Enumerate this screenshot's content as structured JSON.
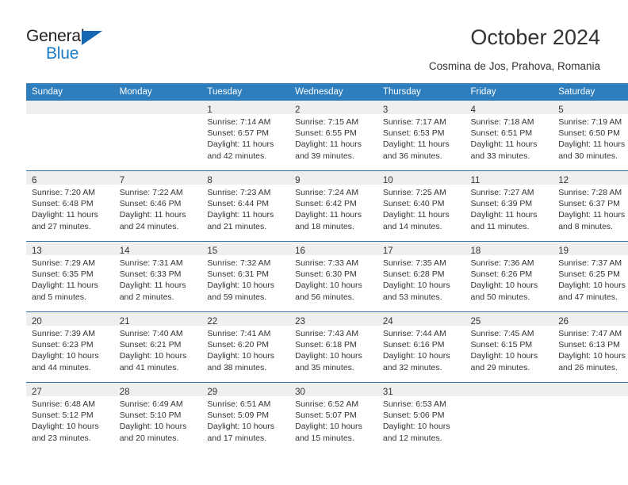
{
  "brand": {
    "name_top": "General",
    "name_bottom": "Blue",
    "triangle_color": "#1668b3",
    "blue_text_color": "#1a7cc4"
  },
  "header": {
    "title": "October 2024",
    "subtitle": "Cosmina de Jos, Prahova, Romania"
  },
  "calendar": {
    "header_bg": "#2e7ebd",
    "row_divider_color": "#2e6da4",
    "date_strip_bg": "#efefef",
    "weekday_headers": [
      "Sunday",
      "Monday",
      "Tuesday",
      "Wednesday",
      "Thursday",
      "Friday",
      "Saturday"
    ],
    "weeks": [
      [
        {
          "date": "",
          "lines": []
        },
        {
          "date": "",
          "lines": []
        },
        {
          "date": "1",
          "lines": [
            "Sunrise: 7:14 AM",
            "Sunset: 6:57 PM",
            "Daylight: 11 hours",
            "and 42 minutes."
          ]
        },
        {
          "date": "2",
          "lines": [
            "Sunrise: 7:15 AM",
            "Sunset: 6:55 PM",
            "Daylight: 11 hours",
            "and 39 minutes."
          ]
        },
        {
          "date": "3",
          "lines": [
            "Sunrise: 7:17 AM",
            "Sunset: 6:53 PM",
            "Daylight: 11 hours",
            "and 36 minutes."
          ]
        },
        {
          "date": "4",
          "lines": [
            "Sunrise: 7:18 AM",
            "Sunset: 6:51 PM",
            "Daylight: 11 hours",
            "and 33 minutes."
          ]
        },
        {
          "date": "5",
          "lines": [
            "Sunrise: 7:19 AM",
            "Sunset: 6:50 PM",
            "Daylight: 11 hours",
            "and 30 minutes."
          ]
        }
      ],
      [
        {
          "date": "6",
          "lines": [
            "Sunrise: 7:20 AM",
            "Sunset: 6:48 PM",
            "Daylight: 11 hours",
            "and 27 minutes."
          ]
        },
        {
          "date": "7",
          "lines": [
            "Sunrise: 7:22 AM",
            "Sunset: 6:46 PM",
            "Daylight: 11 hours",
            "and 24 minutes."
          ]
        },
        {
          "date": "8",
          "lines": [
            "Sunrise: 7:23 AM",
            "Sunset: 6:44 PM",
            "Daylight: 11 hours",
            "and 21 minutes."
          ]
        },
        {
          "date": "9",
          "lines": [
            "Sunrise: 7:24 AM",
            "Sunset: 6:42 PM",
            "Daylight: 11 hours",
            "and 18 minutes."
          ]
        },
        {
          "date": "10",
          "lines": [
            "Sunrise: 7:25 AM",
            "Sunset: 6:40 PM",
            "Daylight: 11 hours",
            "and 14 minutes."
          ]
        },
        {
          "date": "11",
          "lines": [
            "Sunrise: 7:27 AM",
            "Sunset: 6:39 PM",
            "Daylight: 11 hours",
            "and 11 minutes."
          ]
        },
        {
          "date": "12",
          "lines": [
            "Sunrise: 7:28 AM",
            "Sunset: 6:37 PM",
            "Daylight: 11 hours",
            "and 8 minutes."
          ]
        }
      ],
      [
        {
          "date": "13",
          "lines": [
            "Sunrise: 7:29 AM",
            "Sunset: 6:35 PM",
            "Daylight: 11 hours",
            "and 5 minutes."
          ]
        },
        {
          "date": "14",
          "lines": [
            "Sunrise: 7:31 AM",
            "Sunset: 6:33 PM",
            "Daylight: 11 hours",
            "and 2 minutes."
          ]
        },
        {
          "date": "15",
          "lines": [
            "Sunrise: 7:32 AM",
            "Sunset: 6:31 PM",
            "Daylight: 10 hours",
            "and 59 minutes."
          ]
        },
        {
          "date": "16",
          "lines": [
            "Sunrise: 7:33 AM",
            "Sunset: 6:30 PM",
            "Daylight: 10 hours",
            "and 56 minutes."
          ]
        },
        {
          "date": "17",
          "lines": [
            "Sunrise: 7:35 AM",
            "Sunset: 6:28 PM",
            "Daylight: 10 hours",
            "and 53 minutes."
          ]
        },
        {
          "date": "18",
          "lines": [
            "Sunrise: 7:36 AM",
            "Sunset: 6:26 PM",
            "Daylight: 10 hours",
            "and 50 minutes."
          ]
        },
        {
          "date": "19",
          "lines": [
            "Sunrise: 7:37 AM",
            "Sunset: 6:25 PM",
            "Daylight: 10 hours",
            "and 47 minutes."
          ]
        }
      ],
      [
        {
          "date": "20",
          "lines": [
            "Sunrise: 7:39 AM",
            "Sunset: 6:23 PM",
            "Daylight: 10 hours",
            "and 44 minutes."
          ]
        },
        {
          "date": "21",
          "lines": [
            "Sunrise: 7:40 AM",
            "Sunset: 6:21 PM",
            "Daylight: 10 hours",
            "and 41 minutes."
          ]
        },
        {
          "date": "22",
          "lines": [
            "Sunrise: 7:41 AM",
            "Sunset: 6:20 PM",
            "Daylight: 10 hours",
            "and 38 minutes."
          ]
        },
        {
          "date": "23",
          "lines": [
            "Sunrise: 7:43 AM",
            "Sunset: 6:18 PM",
            "Daylight: 10 hours",
            "and 35 minutes."
          ]
        },
        {
          "date": "24",
          "lines": [
            "Sunrise: 7:44 AM",
            "Sunset: 6:16 PM",
            "Daylight: 10 hours",
            "and 32 minutes."
          ]
        },
        {
          "date": "25",
          "lines": [
            "Sunrise: 7:45 AM",
            "Sunset: 6:15 PM",
            "Daylight: 10 hours",
            "and 29 minutes."
          ]
        },
        {
          "date": "26",
          "lines": [
            "Sunrise: 7:47 AM",
            "Sunset: 6:13 PM",
            "Daylight: 10 hours",
            "and 26 minutes."
          ]
        }
      ],
      [
        {
          "date": "27",
          "lines": [
            "Sunrise: 6:48 AM",
            "Sunset: 5:12 PM",
            "Daylight: 10 hours",
            "and 23 minutes."
          ]
        },
        {
          "date": "28",
          "lines": [
            "Sunrise: 6:49 AM",
            "Sunset: 5:10 PM",
            "Daylight: 10 hours",
            "and 20 minutes."
          ]
        },
        {
          "date": "29",
          "lines": [
            "Sunrise: 6:51 AM",
            "Sunset: 5:09 PM",
            "Daylight: 10 hours",
            "and 17 minutes."
          ]
        },
        {
          "date": "30",
          "lines": [
            "Sunrise: 6:52 AM",
            "Sunset: 5:07 PM",
            "Daylight: 10 hours",
            "and 15 minutes."
          ]
        },
        {
          "date": "31",
          "lines": [
            "Sunrise: 6:53 AM",
            "Sunset: 5:06 PM",
            "Daylight: 10 hours",
            "and 12 minutes."
          ]
        },
        {
          "date": "",
          "lines": []
        },
        {
          "date": "",
          "lines": []
        }
      ]
    ]
  }
}
